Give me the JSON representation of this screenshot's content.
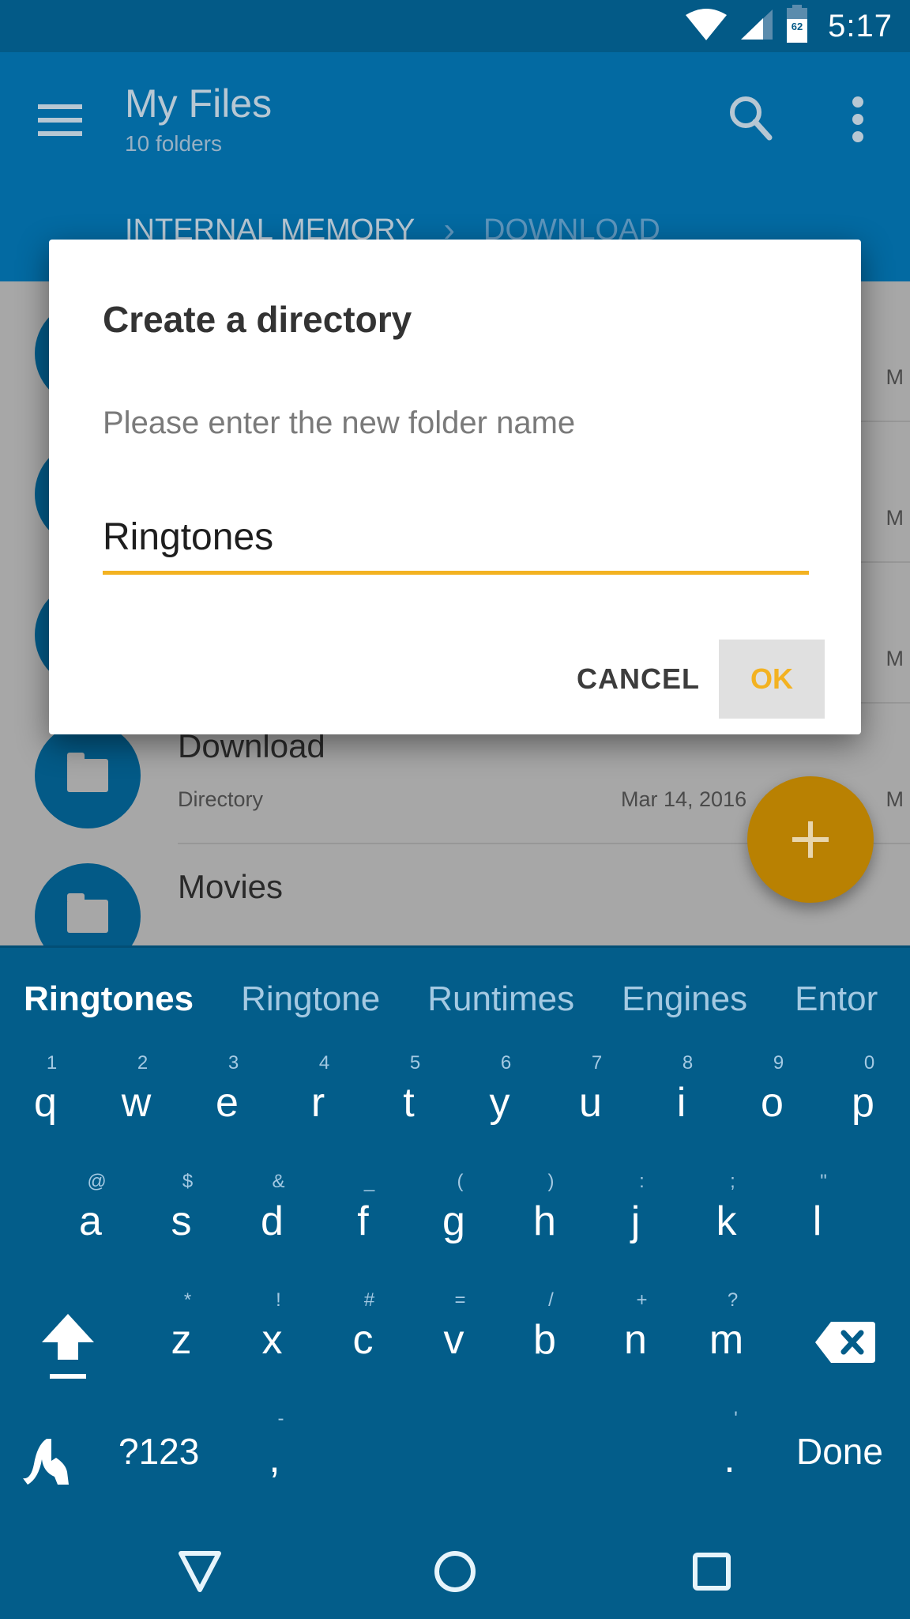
{
  "status_bar": {
    "time": "5:17",
    "battery_level": "62",
    "icons": [
      "wifi-icon",
      "cell-signal-icon",
      "battery-icon"
    ]
  },
  "app_bar": {
    "title": "My Files",
    "subtitle": "10 folders",
    "icons": [
      "menu-icon",
      "search-icon",
      "more-vert-icon"
    ],
    "breadcrumb": [
      "INTERNAL MEMORY",
      "DOWNLOAD"
    ]
  },
  "list": {
    "items": [
      {
        "name": "",
        "type": "",
        "date": "",
        "time_fragment": "M"
      },
      {
        "name": "",
        "type": "",
        "date": "",
        "time_fragment": "M"
      },
      {
        "name": "",
        "type": "",
        "date": "",
        "time_fragment": "M"
      },
      {
        "name": "Download",
        "type": "Directory",
        "date": "Mar 14, 2016",
        "time_fragment": "M"
      },
      {
        "name": "Movies",
        "type": "",
        "date": "",
        "time_fragment": ""
      }
    ]
  },
  "fab": {
    "icon": "plus-icon"
  },
  "dialog": {
    "title": "Create a directory",
    "message": "Please enter the new folder name",
    "input_value": "Ringtones",
    "cancel_label": "CANCEL",
    "ok_label": "OK"
  },
  "keyboard": {
    "suggestions": [
      "Ringtones",
      "Ringtone",
      "Runtimes",
      "Engines",
      "Entor"
    ],
    "row1": [
      {
        "key": "q",
        "hint": "1"
      },
      {
        "key": "w",
        "hint": "2"
      },
      {
        "key": "e",
        "hint": "3"
      },
      {
        "key": "r",
        "hint": "4"
      },
      {
        "key": "t",
        "hint": "5"
      },
      {
        "key": "y",
        "hint": "6"
      },
      {
        "key": "u",
        "hint": "7"
      },
      {
        "key": "i",
        "hint": "8"
      },
      {
        "key": "o",
        "hint": "9"
      },
      {
        "key": "p",
        "hint": "0"
      }
    ],
    "row2": [
      {
        "key": "a",
        "hint": "@"
      },
      {
        "key": "s",
        "hint": "$"
      },
      {
        "key": "d",
        "hint": "&"
      },
      {
        "key": "f",
        "hint": "_"
      },
      {
        "key": "g",
        "hint": "("
      },
      {
        "key": "h",
        "hint": ")"
      },
      {
        "key": "j",
        "hint": ":"
      },
      {
        "key": "k",
        "hint": ";"
      },
      {
        "key": "l",
        "hint": "\""
      }
    ],
    "row3": [
      {
        "key": "z",
        "hint": "*"
      },
      {
        "key": "x",
        "hint": "!"
      },
      {
        "key": "c",
        "hint": "#"
      },
      {
        "key": "v",
        "hint": "="
      },
      {
        "key": "b",
        "hint": "/"
      },
      {
        "key": "n",
        "hint": "+"
      },
      {
        "key": "m",
        "hint": "?"
      }
    ],
    "symbols_label": "?123",
    "comma": ",",
    "comma_hint": "-",
    "period": ".",
    "period_hint": "'",
    "done_label": "Done",
    "icons": [
      "shift-icon",
      "backspace-icon",
      "gesture-typing-icon"
    ]
  },
  "nav_bar": {
    "icons": [
      "back-icon",
      "home-icon",
      "recents-icon"
    ]
  },
  "colors": {
    "primary": "#036aa2",
    "primary_dark": "#035a87",
    "accent": "#f3b221",
    "fab_dimmed": "#b98102"
  }
}
